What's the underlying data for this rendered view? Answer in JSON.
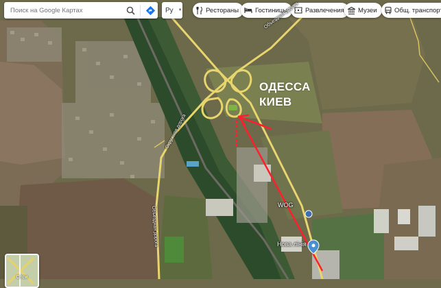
{
  "search": {
    "placeholder": "Поиск на Google Картах",
    "search_icon": "search-icon",
    "directions_icon": "directions-icon"
  },
  "language": {
    "value": "Ру"
  },
  "categories": [
    {
      "label": "Рестораны",
      "icon": "restaurant-icon"
    },
    {
      "label": "Гостиницы",
      "icon": "hotel-icon"
    },
    {
      "label": "Развлечения",
      "icon": "ticket-icon"
    },
    {
      "label": "Музеи",
      "icon": "museum-icon"
    },
    {
      "label": "Общ. транспорт",
      "icon": "bus-icon"
    }
  ],
  "overlay": {
    "line1": "ОДЕССА",
    "line2": "КИЕВ",
    "color": "#ffffff",
    "arrow_color": "#ff1e2d"
  },
  "labels": {
    "wog": "WOG",
    "nova_liniia": "Нова лінія",
    "road_upper": "Объездная дорога",
    "road_left": "Окружная дорога",
    "road_lower": "Объездная дорога"
  },
  "layers": {
    "label": "Слои"
  },
  "colors": {
    "road": "#e8d56e",
    "route_badge": "#7cb342",
    "pin": "#4a8fd0"
  }
}
